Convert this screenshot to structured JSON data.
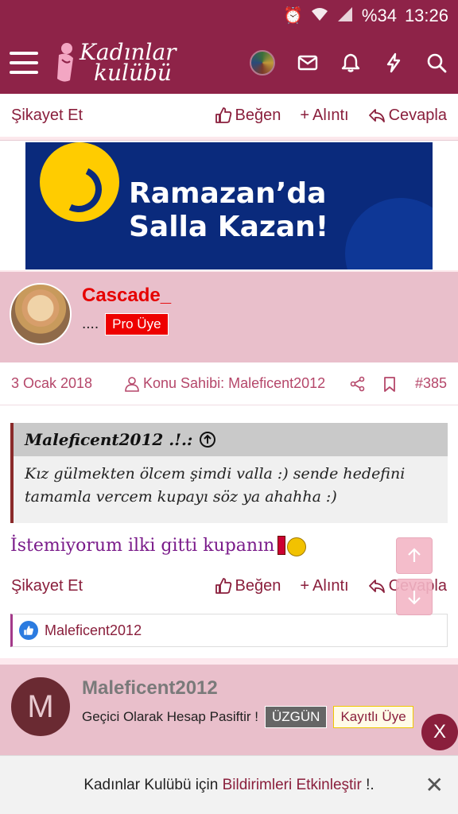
{
  "status_bar": {
    "battery": "%34",
    "time": "13:26"
  },
  "header": {
    "logo_line1": "Kadınlar",
    "logo_line2": "kulübü"
  },
  "top_actions": {
    "report": "Şikayet Et",
    "like": "Beğen",
    "quote": "Alıntı",
    "reply": "Cevapla"
  },
  "ad": {
    "line1": "Ramazan’da",
    "line2": "Salla Kazan!"
  },
  "post_user": {
    "name": "Cascade_",
    "status": "....",
    "badge": "Pro Üye",
    "name_color": "#e60000"
  },
  "post_meta": {
    "date": "3 Ocak 2018",
    "owner": "Konu Sahibi: Maleficent2012",
    "number": "#385"
  },
  "quote": {
    "author": "Maleficent2012 .!.:",
    "text": "Kız gülmekten ölcem şimdi valla :) sende hedefini tamamla vercem kupayı söz ya ahahha :)"
  },
  "post_text": "İstemiyorum ilki gitti kupanın",
  "bottom_actions": {
    "report": "Şikayet Et",
    "like": "Beğen",
    "quote": "Alıntı",
    "reply": "Cevapla"
  },
  "likes": {
    "user": "Maleficent2012"
  },
  "next_user": {
    "initial": "M",
    "name": "Maleficent2012",
    "status": "Geçici Olarak Hesap Pasiftir !",
    "badge1": "ÜZGÜN",
    "badge2": "Kayıtlı Üye",
    "name_color": "#7a7a7a"
  },
  "close_x": "X",
  "notification": {
    "prefix": "Kadınlar Kulübü için ",
    "link": "Bildirimleri Etkinleştir",
    "suffix": " !.",
    "close": "✕"
  }
}
